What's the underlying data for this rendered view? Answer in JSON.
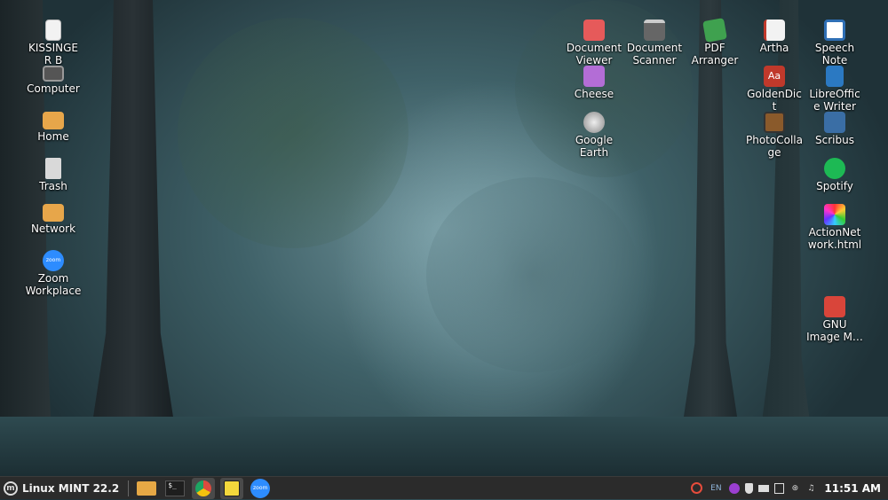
{
  "desktop": {
    "icons": [
      {
        "label": "KISSINGER B",
        "icon": "document-icon",
        "color": "#f2f2f2"
      },
      {
        "label": "Computer",
        "icon": "computer-icon",
        "color": "#555555"
      },
      {
        "label": "Home",
        "icon": "home-folder-icon",
        "color": "#e7a64a"
      },
      {
        "label": "Trash",
        "icon": "trash-icon",
        "color": "#d9d9d9"
      },
      {
        "label": "Network",
        "icon": "network-folder-icon",
        "color": "#e7a64a"
      },
      {
        "label": "Zoom Workplace",
        "icon": "zoom-icon",
        "color": "#2d8cff"
      },
      {
        "label": "Document Viewer",
        "icon": "document-viewer-icon",
        "color": "#e65a5a"
      },
      {
        "label": "Cheese",
        "icon": "cheese-icon",
        "color": "#b36dd6"
      },
      {
        "label": "Google Earth",
        "icon": "google-earth-icon",
        "color": "#cccccc"
      },
      {
        "label": "Document Scanner",
        "icon": "scanner-icon",
        "color": "#666666"
      },
      {
        "label": "PDF Arranger",
        "icon": "pdf-arranger-icon",
        "color": "#3fa14f"
      },
      {
        "label": "Artha",
        "icon": "book-icon",
        "color": "#c0392b"
      },
      {
        "label": "GoldenDict",
        "icon": "dictionary-icon",
        "color": "#c0392b"
      },
      {
        "label": "PhotoCollage",
        "icon": "photo-collage-icon",
        "color": "#8a5a2b"
      },
      {
        "label": "Speech Note",
        "icon": "speech-note-icon",
        "color": "#2f6fb5"
      },
      {
        "label": "LibreOffice Writer",
        "icon": "writer-icon",
        "color": "#2b79c2"
      },
      {
        "label": "Scribus",
        "icon": "scribus-icon",
        "color": "#3a6ea5"
      },
      {
        "label": "Spotify",
        "icon": "spotify-icon",
        "color": "#1db954"
      },
      {
        "label": "ActionNetwork.html",
        "icon": "html-file-icon",
        "color": "#b04ae0"
      },
      {
        "label": "GNU Image M…",
        "icon": "gimp-icon",
        "color": "#d9453a"
      }
    ]
  },
  "taskbar": {
    "menu_label": "Linux MINT 22.2",
    "launchers": [
      {
        "name": "files-icon",
        "color": "#e6a845"
      },
      {
        "name": "terminal-icon",
        "color": "#1e1e1e",
        "text": "$_"
      },
      {
        "name": "chrome-icon",
        "color": "#dd4b3e"
      },
      {
        "name": "sticky-notes-icon",
        "color": "#f4d83c"
      },
      {
        "name": "zoom-icon",
        "color": "#2d8cff",
        "text": "zoom"
      }
    ],
    "tray": {
      "keyboard_layout": "EN",
      "clock": "11:51 AM"
    }
  }
}
